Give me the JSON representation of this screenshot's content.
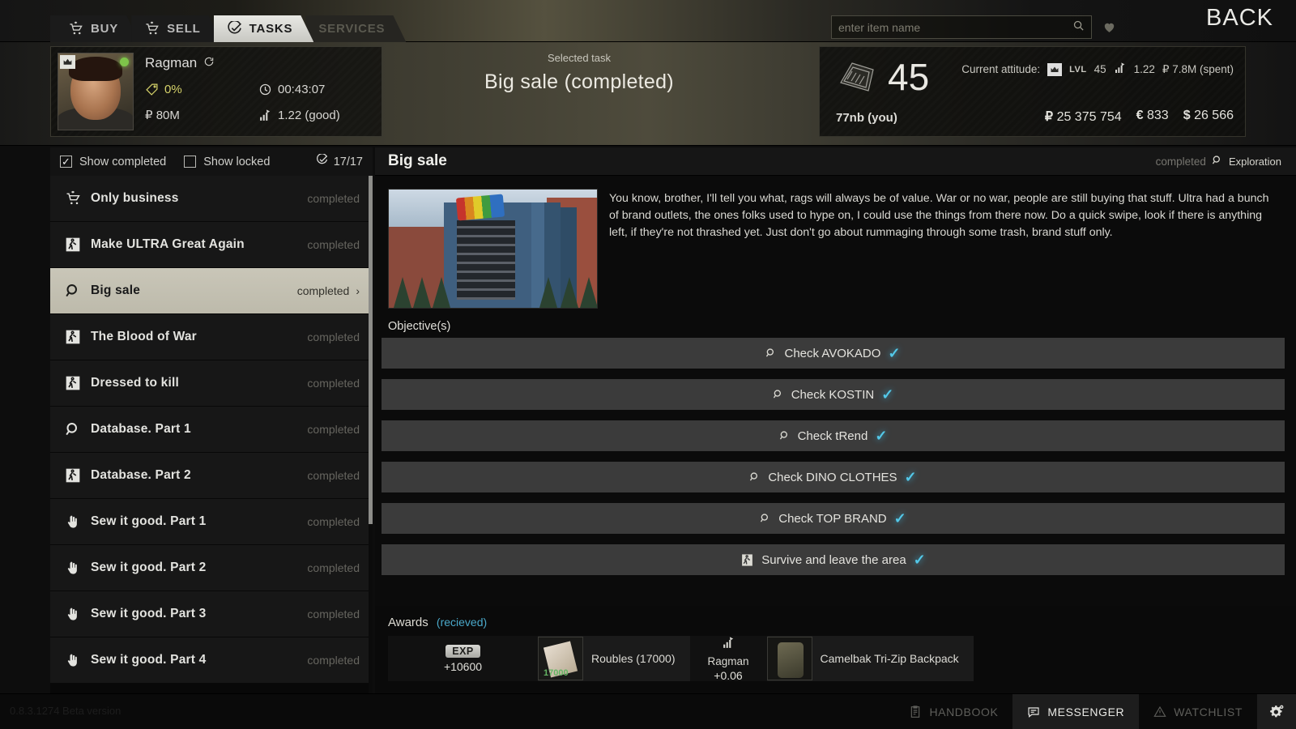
{
  "topbar": {
    "tabs": [
      {
        "label": "BUY",
        "icon": "cart-icon",
        "state": "normal"
      },
      {
        "label": "SELL",
        "icon": "cart-icon",
        "state": "normal"
      },
      {
        "label": "TASKS",
        "icon": "task-check-icon",
        "state": "active"
      },
      {
        "label": "SERVICES",
        "icon": "none",
        "state": "disabled"
      }
    ],
    "search": {
      "placeholder": "enter item name",
      "value": "",
      "icon": "search-icon"
    },
    "favorite_icon": "heart-icon",
    "back_label": "BACK"
  },
  "trader": {
    "name": "Ragman",
    "refresh_icon": "refresh-icon",
    "discount": "0%",
    "discount_icon": "discount-tag-icon",
    "timer": "00:43:07",
    "timer_icon": "clock-icon",
    "cash": "₽ 80M",
    "loyalty": "1.22 (good)",
    "loyalty_icon": "chart-up-icon",
    "status": "online",
    "crown_icon": "crown-icon"
  },
  "selected_task": {
    "label": "Selected task",
    "value": "Big sale (completed)"
  },
  "player": {
    "level": "45",
    "rank_icon": "rank-insignia-icon",
    "name": "77nb (you)",
    "attitude_label": "Current attitude:",
    "attitude_crown_icon": "crown-icon",
    "lvl_tag": "LVL",
    "lvl_value": "45",
    "rep_icon": "chart-up-icon",
    "rep_value": "1.22",
    "spent": "₽ 7.8M (spent)",
    "currencies": [
      {
        "symbol": "₽",
        "amount": "25 375 754"
      },
      {
        "symbol": "€",
        "amount": "833"
      },
      {
        "symbol": "$",
        "amount": "26 566"
      }
    ]
  },
  "filters": {
    "show_completed": {
      "label": "Show completed",
      "checked": true
    },
    "show_locked": {
      "label": "Show locked",
      "checked": false
    },
    "counter": "17/17",
    "counter_icon": "task-check-icon"
  },
  "task_list": [
    {
      "name": "Only business",
      "status": "completed",
      "icon": "cart-icon",
      "selected": false
    },
    {
      "name": "Make ULTRA Great Again",
      "status": "completed",
      "icon": "exit-icon",
      "selected": false
    },
    {
      "name": "Big sale",
      "status": "completed",
      "icon": "search-icon",
      "selected": true,
      "chevron": "›"
    },
    {
      "name": "The Blood of War",
      "status": "completed",
      "icon": "exit-icon",
      "selected": false
    },
    {
      "name": "Dressed to kill",
      "status": "completed",
      "icon": "exit-icon",
      "selected": false
    },
    {
      "name": "Database. Part 1",
      "status": "completed",
      "icon": "search-icon",
      "selected": false
    },
    {
      "name": "Database. Part 2",
      "status": "completed",
      "icon": "exit-icon",
      "selected": false
    },
    {
      "name": "Sew it good. Part 1",
      "status": "completed",
      "icon": "hand-icon",
      "selected": false
    },
    {
      "name": "Sew it good. Part 2",
      "status": "completed",
      "icon": "hand-icon",
      "selected": false
    },
    {
      "name": "Sew it good. Part 3",
      "status": "completed",
      "icon": "hand-icon",
      "selected": false
    },
    {
      "name": "Sew it good. Part 4",
      "status": "completed",
      "icon": "hand-icon",
      "selected": false
    }
  ],
  "detail": {
    "title": "Big sale",
    "status": "completed",
    "category": "Exploration",
    "category_icon": "search-icon",
    "image_alt": "ULTRA shopping mall exterior",
    "description": "You know, brother, I'll tell you what, rags will always be of value. War or no war, people are still buying that stuff. Ultra had a bunch of brand outlets, the ones folks used to hype on, I could use the things from there now. Do a quick swipe, look if there is anything left, if they're not thrashed yet. Just don't go about rummaging through some trash, brand stuff only.",
    "objectives_label": "Objective(s)",
    "objectives": [
      {
        "text": "Check AVOKADO",
        "icon": "search-icon",
        "done": true,
        "check": "✓"
      },
      {
        "text": "Check KOSTIN",
        "icon": "search-icon",
        "done": true,
        "check": "✓"
      },
      {
        "text": "Check tRend",
        "icon": "search-icon",
        "done": true,
        "check": "✓"
      },
      {
        "text": "Check DINO CLOTHES",
        "icon": "search-icon",
        "done": true,
        "check": "✓"
      },
      {
        "text": "Check TOP BRAND",
        "icon": "search-icon",
        "done": true,
        "check": "✓"
      },
      {
        "text": "Survive and leave the area",
        "icon": "exit-icon",
        "done": true,
        "check": "✓"
      }
    ],
    "awards_label": "Awards",
    "awards_state": "(recieved)",
    "awards": {
      "exp": {
        "badge": "EXP",
        "value": "+10600"
      },
      "money": {
        "name": "Roubles (17000)",
        "icon_amount": "17000",
        "icon": "cash-stack-icon"
      },
      "reputation": {
        "icon": "chart-up-icon",
        "trader": "Ragman",
        "value": "+0.06"
      },
      "item": {
        "name": "Camelbak Tri-Zip Backpack",
        "icon": "backpack-icon"
      }
    }
  },
  "bottombar": {
    "version": "0.8.3.1274 Beta version",
    "items": [
      {
        "label": "HANDBOOK",
        "icon": "handbook-icon",
        "active": false
      },
      {
        "label": "MESSENGER",
        "icon": "messenger-icon",
        "active": true
      },
      {
        "label": "WATCHLIST",
        "icon": "warning-icon",
        "active": false
      }
    ],
    "settings_icon": "gear-icon"
  },
  "colors": {
    "accent_check": "#53c8e8",
    "accent_link": "#4aa8c9",
    "online": "#7ec44a",
    "discount": "#d6d36a",
    "selected_row": "#c9c6b8"
  }
}
